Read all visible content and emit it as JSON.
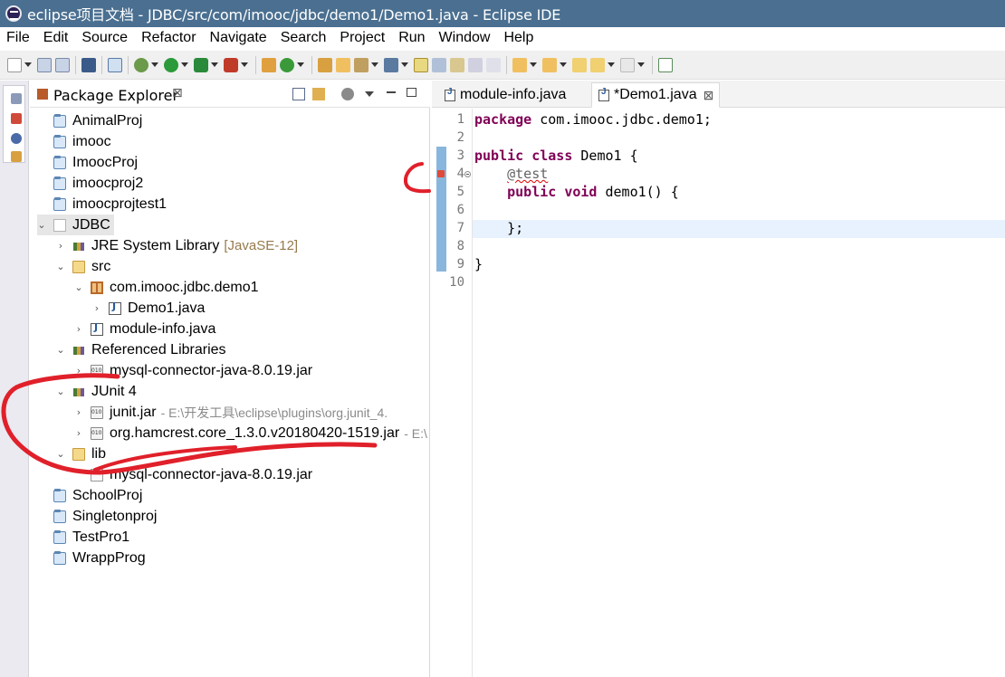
{
  "window": {
    "title": "eclipse项目文档 - JDBC/src/com/imooc/jdbc/demo1/Demo1.java - Eclipse IDE"
  },
  "menu": [
    "File",
    "Edit",
    "Source",
    "Refactor",
    "Navigate",
    "Search",
    "Project",
    "Run",
    "Window",
    "Help"
  ],
  "explorer": {
    "title": "Package Explorer",
    "close": "⊠",
    "tree": [
      {
        "label": "AnimalProj",
        "icon": "project-icon"
      },
      {
        "label": "imooc",
        "icon": "project-icon"
      },
      {
        "label": "ImoocProj",
        "icon": "project-icon"
      },
      {
        "label": "imoocproj2",
        "icon": "project-icon"
      },
      {
        "label": "imoocprojtest1",
        "icon": "project-icon"
      },
      {
        "label": "JDBC",
        "icon": "project-open-icon",
        "twisty": "⌄"
      },
      {
        "label": "JRE System Library",
        "decor": "[JavaSE-12]",
        "icon": "library-icon",
        "twisty": "›"
      },
      {
        "label": "src",
        "icon": "source-folder-icon",
        "twisty": "⌄"
      },
      {
        "label": "com.imooc.jdbc.demo1",
        "icon": "package-icon",
        "twisty": "⌄"
      },
      {
        "label": "Demo1.java",
        "icon": "java-file-icon",
        "twisty": "›"
      },
      {
        "label": "module-info.java",
        "icon": "java-file-icon",
        "twisty": "›"
      },
      {
        "label": "Referenced Libraries",
        "icon": "library-icon",
        "twisty": "⌄"
      },
      {
        "label": "mysql-connector-java-8.0.19.jar",
        "icon": "jar-icon",
        "twisty": "›"
      },
      {
        "label": "JUnit 4",
        "icon": "library-icon",
        "twisty": "⌄"
      },
      {
        "label": "junit.jar",
        "suffix": "- E:\\开发工具\\eclipse\\plugins\\org.junit_4.",
        "icon": "jar-icon",
        "twisty": "›"
      },
      {
        "label": "org.hamcrest.core_1.3.0.v20180420-1519.jar",
        "suffix": "- E:\\",
        "icon": "jar-icon",
        "twisty": "›"
      },
      {
        "label": "lib",
        "icon": "folder-icon",
        "twisty": "⌄"
      },
      {
        "label": "mysql-connector-java-8.0.19.jar",
        "icon": "file-icon"
      },
      {
        "label": "SchoolProj",
        "icon": "project-icon"
      },
      {
        "label": "Singletonproj",
        "icon": "project-icon"
      },
      {
        "label": "TestPro1",
        "icon": "project-icon"
      },
      {
        "label": "WrappProg",
        "icon": "project-icon"
      }
    ]
  },
  "editor": {
    "tabs": [
      {
        "label": "module-info.java",
        "active": false
      },
      {
        "label": "*Demo1.java",
        "active": true,
        "close": "⊠"
      }
    ],
    "line_numbers": [
      "1",
      "2",
      "3",
      "4",
      "5",
      "6",
      "7",
      "8",
      "9",
      "10"
    ],
    "code": {
      "l1_kw": "package",
      "l1_rest": " com.imooc.jdbc.demo1;",
      "l3_kw1": "public",
      "l3_kw2": "class",
      "l3_rest": " Demo1 {",
      "l4_ann": "@test",
      "l5_kw1": "public",
      "l5_kw2": "void",
      "l5_rest": " demo1() {",
      "l7": "    };",
      "l9": "}"
    }
  },
  "colors": {
    "title_bar": "#4a6f90",
    "keyword": "#7f0055",
    "annotation_stroke": "#e0202a",
    "quick_diff": "#89b6dc"
  }
}
